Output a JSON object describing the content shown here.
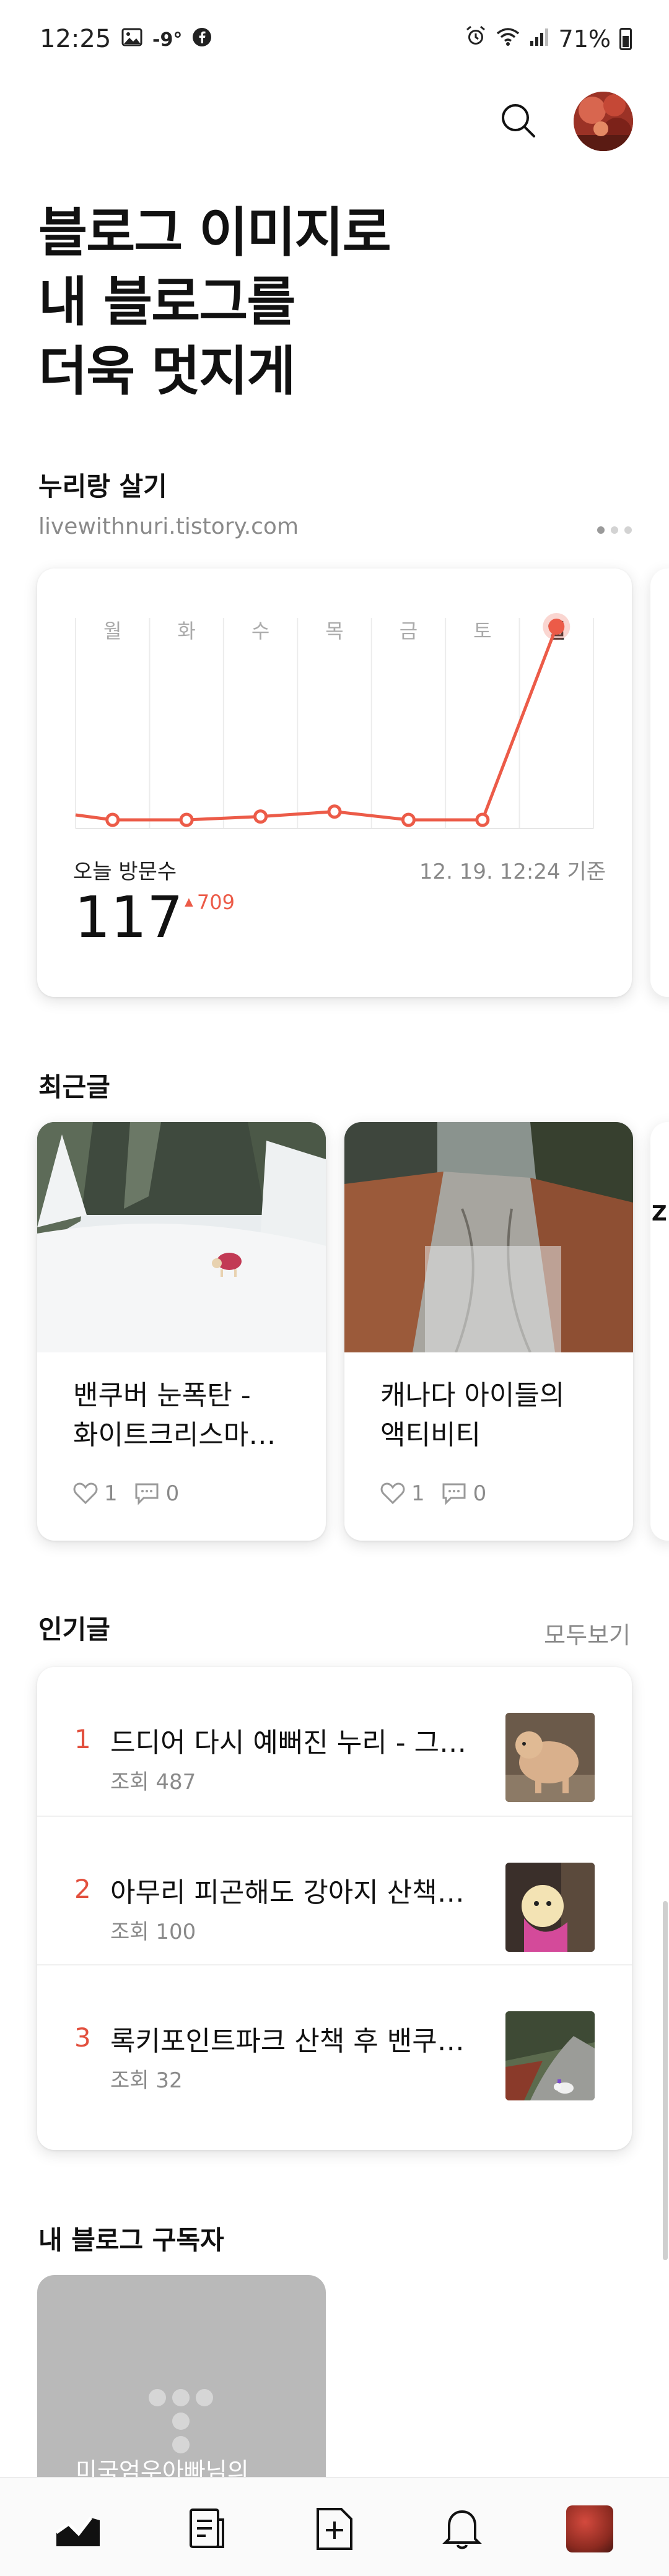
{
  "status_bar": {
    "time": "12:25",
    "temperature": "-9°",
    "battery": "71%",
    "left_icons": [
      "gallery-icon",
      "facebook-icon"
    ],
    "right_icons": [
      "alarm-icon",
      "wifi-icon",
      "signal-icon",
      "battery-icon"
    ]
  },
  "header": {
    "search_icon": "search-icon",
    "avatar": "profile-avatar"
  },
  "hero": {
    "line1": "블로그 이미지로",
    "line2": "내 블로그를",
    "line3": "더욱 멋지게"
  },
  "blog": {
    "name": "누리랑 살기",
    "url": "livewithnuri.tistory.com",
    "pager_total": 3,
    "pager_active": 1
  },
  "visitors": {
    "label": "오늘 방문수",
    "count": "117",
    "delta": "709",
    "timestamp": "12. 19. 12:24 기준"
  },
  "chart_data": {
    "type": "line",
    "categories": [
      "월",
      "화",
      "수",
      "목",
      "금",
      "토",
      "일"
    ],
    "values": [
      0,
      0,
      2,
      5,
      0,
      0,
      117
    ],
    "highlight_index": 6,
    "color": "#ec5b48",
    "ylim": [
      0,
      120
    ]
  },
  "recent": {
    "title": "최근글",
    "posts": [
      {
        "title_line1": "밴쿠버 눈폭탄 -",
        "title_line2": "화이트크리스마…",
        "likes": "1",
        "comments": "0"
      },
      {
        "title_line1": "캐나다 아이들의",
        "title_line2": "액티비티",
        "likes": "1",
        "comments": "0"
      }
    ],
    "peek_text": "Z"
  },
  "popular": {
    "title": "인기글",
    "see_all": "모두보기",
    "items": [
      {
        "rank": "1",
        "title": "드디어 다시 예뻐진 누리 - 그…",
        "views": "조회 487"
      },
      {
        "rank": "2",
        "title": "아무리 피곤해도 강아지 산책…",
        "views": "조회 100"
      },
      {
        "rank": "3",
        "title": "록키포인트파크 산책 후 밴쿠…",
        "views": "조회 32"
      }
    ]
  },
  "subscribers": {
    "title": "내 블로그 구독자",
    "first_name": "미국엄우아빠님의"
  },
  "bottom_nav": {
    "items": [
      "stats-icon",
      "posts-icon",
      "write-icon",
      "bell-icon",
      "profile-avatar"
    ],
    "active_index": 0
  }
}
